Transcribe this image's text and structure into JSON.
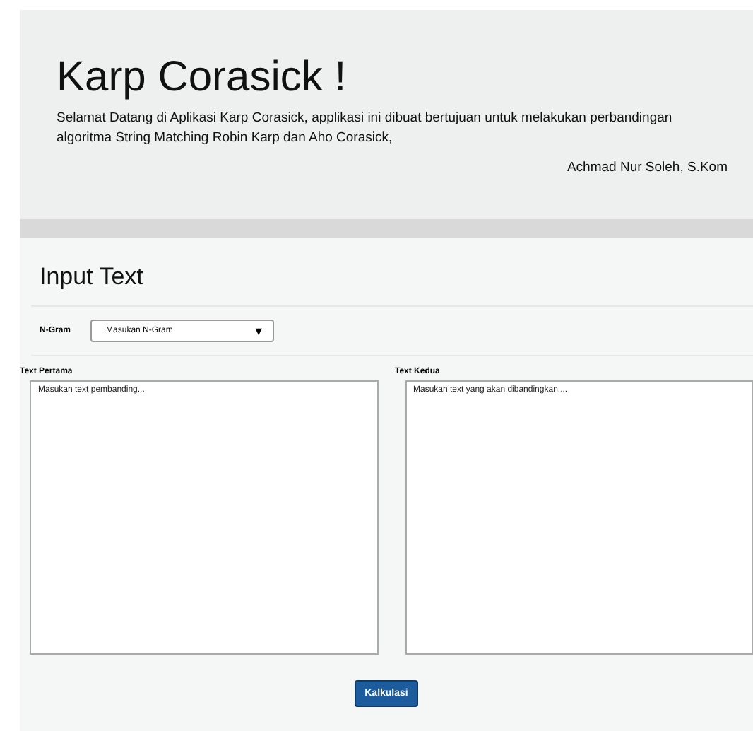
{
  "header": {
    "title": "Karp Corasick !",
    "description": "Selamat Datang di Aplikasi Karp Corasick, applikasi ini dibuat bertujuan untuk melakukan perbandingan algoritma String Matching Robin Karp dan Aho Corasick,",
    "author": "Achmad Nur Soleh, S.Kom"
  },
  "section_title": "Input Text",
  "ngram": {
    "label": "N-Gram",
    "value": "Masukan N-Gram",
    "arrow": "▼"
  },
  "text_fields": [
    {
      "label": "Text Pertama",
      "placeholder": "Masukan text pembanding..."
    },
    {
      "label": "Text Kedua",
      "placeholder": "Masukan text yang akan dibandingkan...."
    }
  ],
  "button": "Kalkulasi"
}
